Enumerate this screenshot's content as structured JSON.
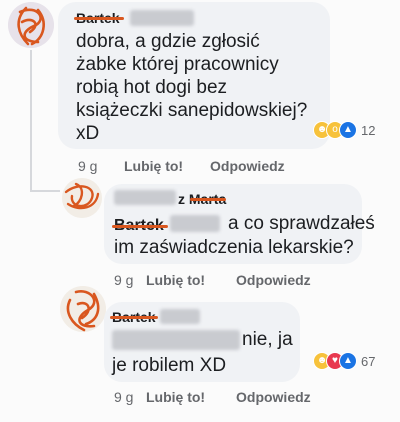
{
  "comments": [
    {
      "author": "Bartek",
      "text_lines": [
        "dobra, a gdzie zgłosić",
        "żabke której pracownicy",
        "robią hot dogi bez",
        "książeczki sanepidowskiej?",
        "xD"
      ],
      "reaction_count": "12",
      "reaction_icons": [
        "haha-icon",
        "wow-icon",
        "like-icon"
      ],
      "time": "9 g",
      "like_label": "Lubię to!",
      "reply_label": "Odpowiedz"
    },
    {
      "author": "z Marta",
      "tag": "Bartek",
      "text_inline": "a co sprawdzałeś",
      "text_line2": "im zaświadczenia lekarskie?",
      "time": "9 g",
      "like_label": "Lubię to!",
      "reply_label": "Odpowiedz"
    },
    {
      "author": "Bartek",
      "text_inline": "nie, ja",
      "text_line2": "je robilem XD",
      "reaction_count": "67",
      "reaction_icons": [
        "haha-icon",
        "love-icon",
        "like-icon"
      ],
      "time": "9 g",
      "like_label": "Lubię to!",
      "reply_label": "Odpowiedz"
    }
  ],
  "colors": {
    "bubble": "#f0f2f5",
    "scribble": "#d9571f",
    "meta_text": "#65676b",
    "like_blue": "#1b74e4",
    "love_red": "#e8384f",
    "haha_yellow": "#f7c23b"
  }
}
